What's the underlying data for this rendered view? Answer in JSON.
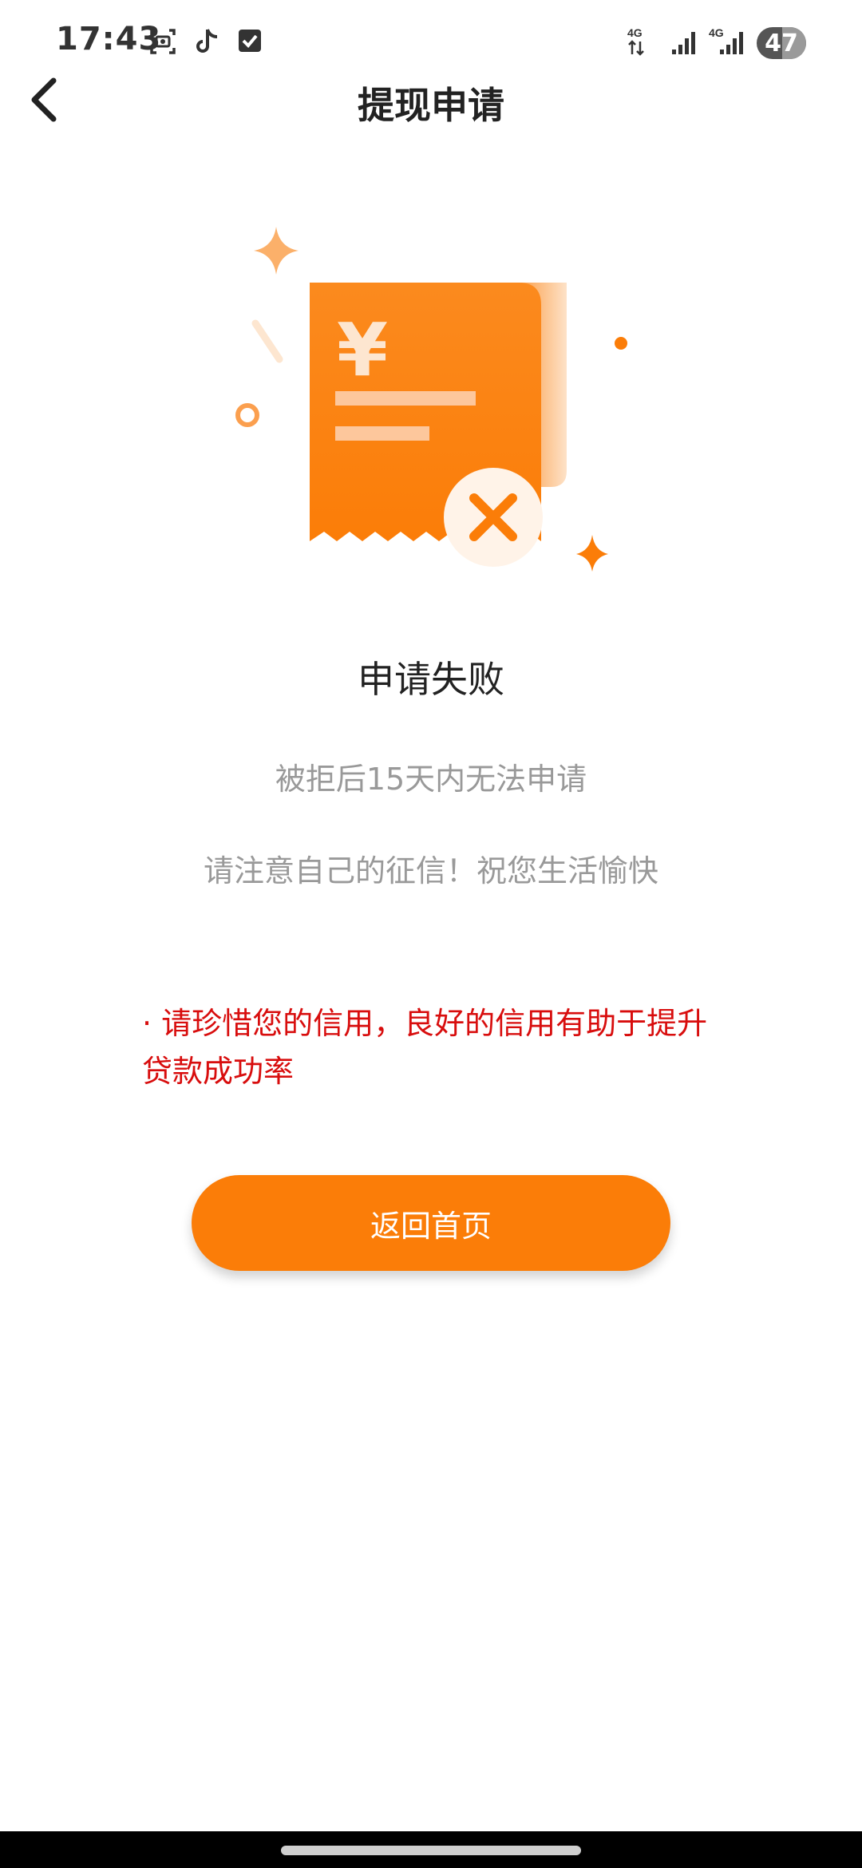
{
  "status_bar": {
    "time": "17:43",
    "icons_left": [
      "screenshot-icon",
      "tiktok-icon",
      "checkbox-icon"
    ],
    "signal_label_1": "4G",
    "signal_label_2": "4G",
    "battery_level": "47"
  },
  "nav": {
    "title": "提现申请",
    "back_icon": "chevron-left-icon"
  },
  "illustration": {
    "icon": "receipt-failed-icon",
    "currency_symbol": "¥"
  },
  "result": {
    "title": "申请失败",
    "line1": "被拒后15天内无法申请",
    "line2": "请注意自己的征信！祝您生活愉快"
  },
  "notice": {
    "text": "· 请珍惜您的信用，良好的信用有助于提升贷款成功率"
  },
  "actions": {
    "home_button_label": "返回首页"
  },
  "colors": {
    "accent": "#fb7d08",
    "warning_text": "#d80d0d",
    "muted_text": "#999999"
  }
}
